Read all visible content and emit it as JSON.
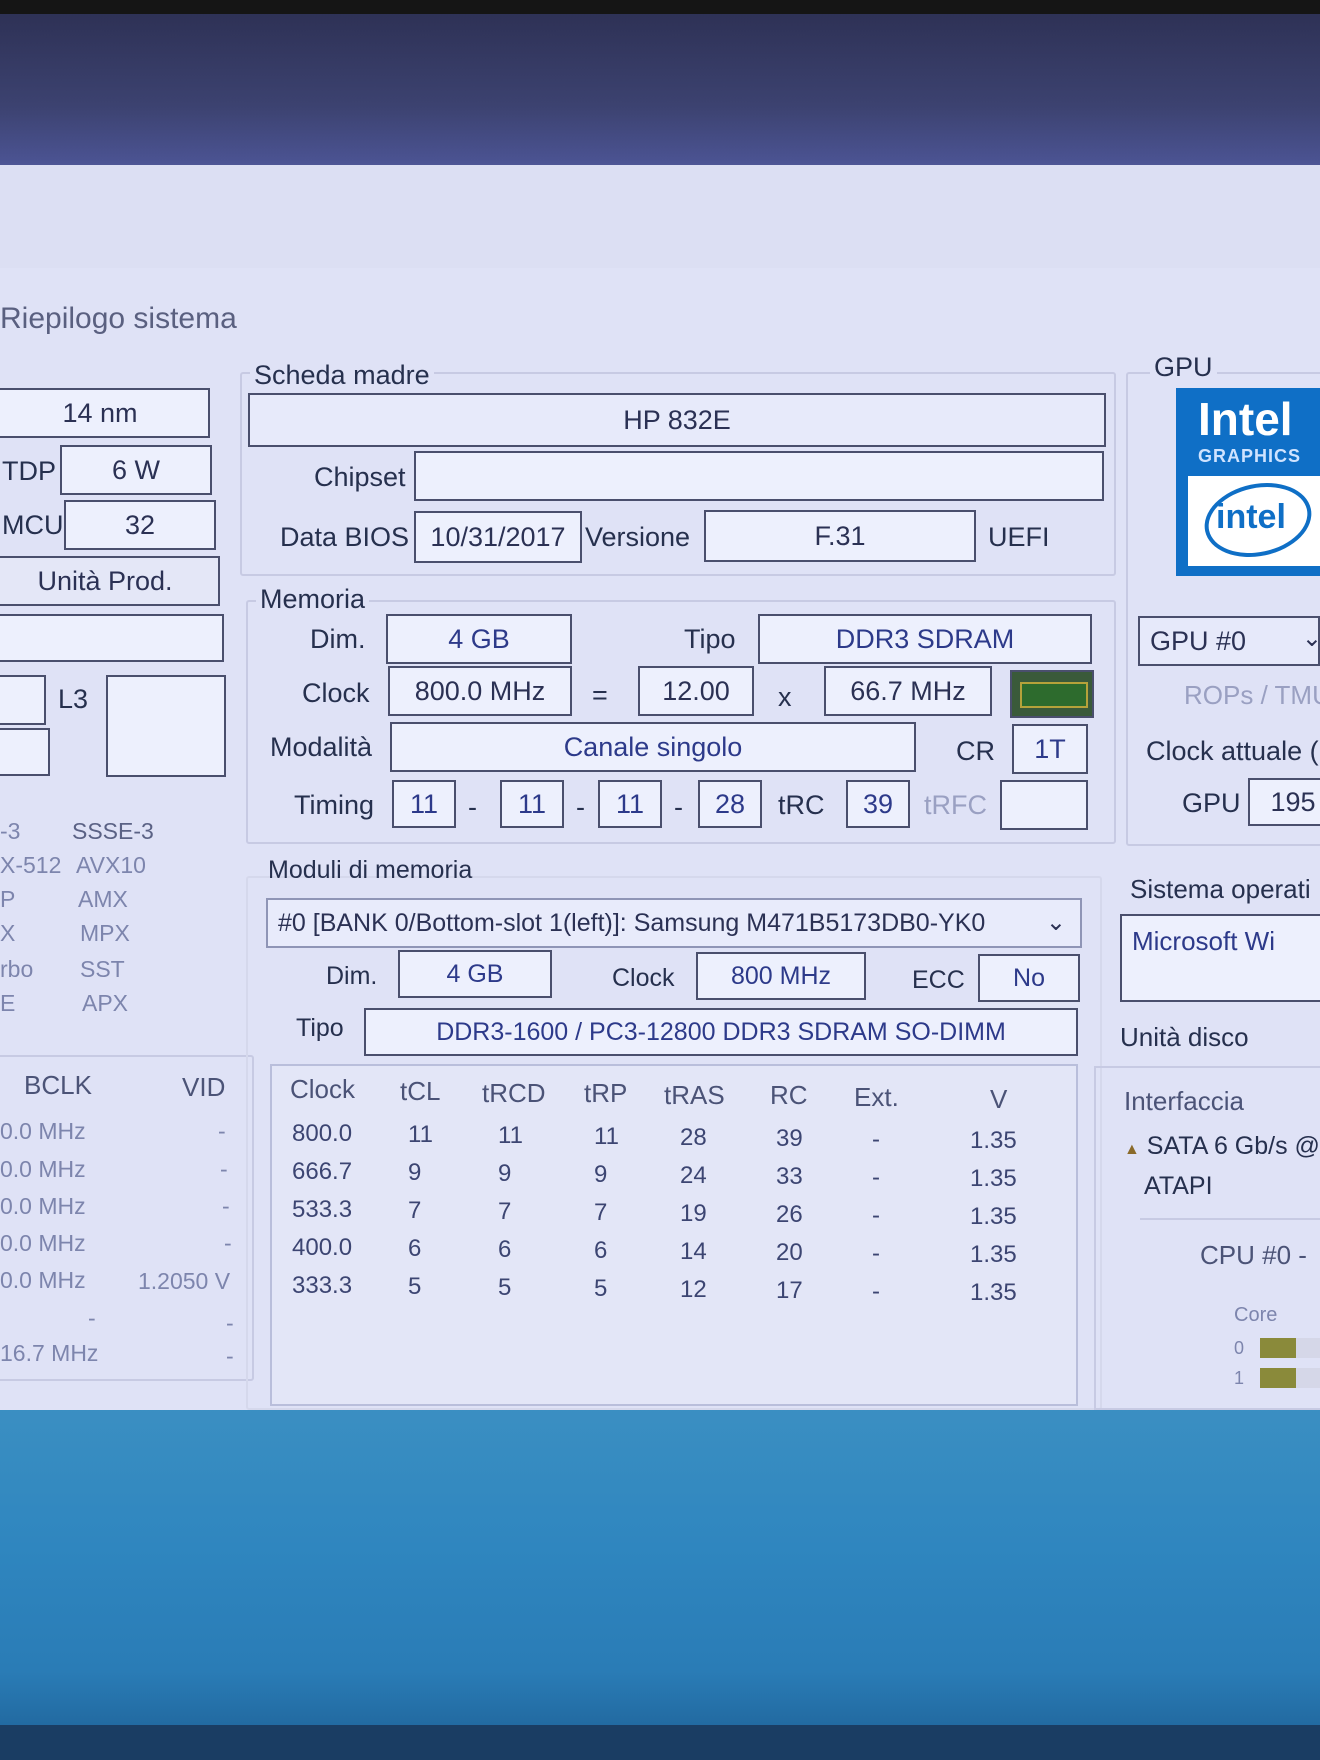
{
  "window_title": "Riepilogo sistema",
  "cpu_panel": {
    "process": "14 nm",
    "tdp_label": "TDP",
    "tdp_value": "6 W",
    "mcu_label": "MCU",
    "mcu_value": "32",
    "unit_button": "Unità Prod.",
    "l3_label": "L3",
    "features": [
      [
        "-3",
        "SSSE-3"
      ],
      [
        "X-512",
        "AVX10"
      ],
      [
        "P",
        "AMX"
      ],
      [
        "X",
        "MPX"
      ],
      [
        "rbo",
        "SST"
      ],
      [
        "E",
        "APX"
      ]
    ],
    "clock_table": {
      "headers": [
        "BCLK",
        "VID"
      ],
      "rows": [
        [
          "0.0 MHz",
          "-"
        ],
        [
          "0.0 MHz",
          "-"
        ],
        [
          "0.0 MHz",
          "-"
        ],
        [
          "0.0 MHz",
          "-"
        ],
        [
          "0.0 MHz",
          "1.2050 V"
        ],
        [
          "-",
          "-"
        ],
        [
          "16.7 MHz",
          "-"
        ]
      ]
    }
  },
  "motherboard": {
    "group_label": "Scheda madre",
    "name": "HP 832E",
    "chipset_label": "Chipset",
    "chipset_value": "",
    "bios_date_label": "Data BIOS",
    "bios_date": "10/31/2017",
    "version_label": "Versione",
    "version": "F.31",
    "uefi": "UEFI"
  },
  "memory": {
    "group_label": "Memoria",
    "size_label": "Dim.",
    "size": "4 GB",
    "type_label": "Tipo",
    "type": "DDR3 SDRAM",
    "clock_label": "Clock",
    "clock": "800.0 MHz",
    "equals": "=",
    "multiplier": "12.00",
    "times": "x",
    "base_clock": "66.7 MHz",
    "mode_label": "Modalità",
    "mode": "Canale singolo",
    "cr_label": "CR",
    "cr": "1T",
    "timing_label": "Timing",
    "timings": [
      "11",
      "11",
      "11",
      "28"
    ],
    "dash": "-",
    "trc_label": "tRC",
    "trc": "39",
    "trfc_label": "tRFC",
    "trfc": ""
  },
  "modules": {
    "group_label": "Moduli di memoria",
    "selected": "#0 [BANK 0/Bottom-slot 1(left)]: Samsung M471B5173DB0-YK0",
    "size_label": "Dim.",
    "size": "4 GB",
    "clock_label": "Clock",
    "clock": "800 MHz",
    "ecc_label": "ECC",
    "ecc": "No",
    "type_label": "Tipo",
    "type": "DDR3-1600 / PC3-12800 DDR3 SDRAM SO-DIMM",
    "table": {
      "headers": [
        "Clock",
        "tCL",
        "tRCD",
        "tRP",
        "tRAS",
        "RC",
        "Ext.",
        "V"
      ],
      "rows": [
        [
          "800.0",
          "11",
          "11",
          "11",
          "28",
          "39",
          "-",
          "1.35"
        ],
        [
          "666.7",
          "9",
          "9",
          "9",
          "24",
          "33",
          "-",
          "1.35"
        ],
        [
          "533.3",
          "7",
          "7",
          "7",
          "19",
          "26",
          "-",
          "1.35"
        ],
        [
          "400.0",
          "6",
          "6",
          "6",
          "14",
          "20",
          "-",
          "1.35"
        ],
        [
          "333.3",
          "5",
          "5",
          "5",
          "12",
          "17",
          "-",
          "1.35"
        ]
      ]
    }
  },
  "gpu": {
    "group_label": "GPU",
    "logo_brand": "Intel",
    "logo_sub": "GRAPHICS",
    "logo_badge": "intel",
    "selector": "GPU #0",
    "rops_label": "ROPs / TMU",
    "clock_label": "Clock attuale (",
    "gpu_label": "GPU",
    "gpu_clock": "195"
  },
  "os": {
    "label": "Sistema operati",
    "value": "Microsoft Wi"
  },
  "drives": {
    "label": "Unità disco",
    "col_header": "Interfaccia",
    "rows": [
      "SATA 6 Gb/s @",
      "ATAPI"
    ],
    "cpu_selector": "CPU #0 -",
    "core_label": "Core",
    "cores": [
      "0",
      "1"
    ],
    "core_load": [
      0.6,
      0.6
    ]
  }
}
